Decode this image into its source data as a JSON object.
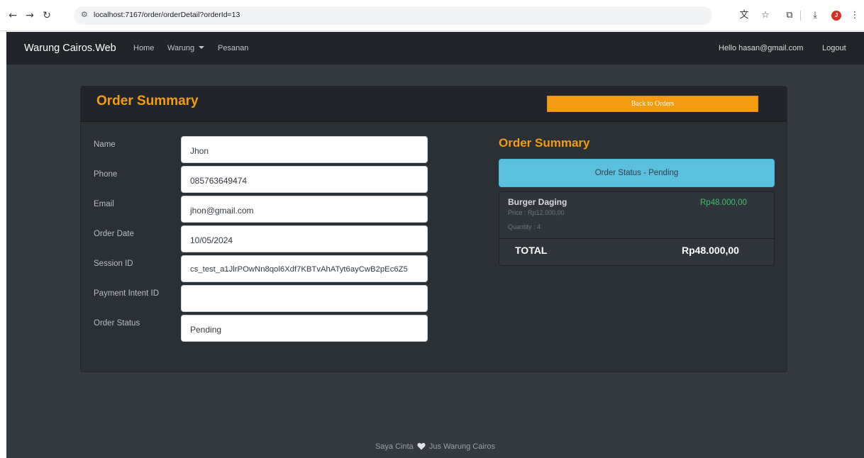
{
  "browser": {
    "url": "localhost:7167/order/orderDetail?orderId=13",
    "profile_initial": "J"
  },
  "navbar": {
    "brand": "Warung Cairos.Web",
    "links": {
      "home": "Home",
      "warung": "Warung",
      "pesanan": "Pesanan"
    },
    "greeting": "Hello hasan@gmail.com",
    "logout": "Logout"
  },
  "card": {
    "title": "Order Summary",
    "back_button": "Back to Orders",
    "fields": {
      "name": {
        "label": "Name",
        "value": "Jhon"
      },
      "phone": {
        "label": "Phone",
        "value": "085763649474"
      },
      "email": {
        "label": "Email",
        "value": "jhon@gmail.com"
      },
      "order_date": {
        "label": "Order Date",
        "value": "10/05/2024"
      },
      "session_id": {
        "label": "Session ID",
        "value": "cs_test_a1JlrPOwNn8qol6Xdf7KBTvAhATyt6ayCwB2pEc6Z5"
      },
      "payment_intent_id": {
        "label": "Payment Intent ID",
        "value": ""
      },
      "order_status": {
        "label": "Order Status",
        "value": "Pending"
      }
    },
    "summary": {
      "title": "Order Summary",
      "status": "Order Status - Pending",
      "item": {
        "name": "Burger Daging",
        "price": "Price : Rp12.000,00",
        "quantity": "Quantity : 4",
        "total": "Rp48.000,00"
      },
      "total_label": "TOTAL",
      "total_value": "Rp48.000,00"
    }
  },
  "footer": {
    "text_before": "Saya Cinta",
    "text_after": "Jus Warung Cairos"
  },
  "colors": {
    "accent": "#f39c12",
    "status_bg": "#5bc0de",
    "item_total": "#3fbf6b",
    "page_bg": "#343a40",
    "navbar_bg": "#212529"
  }
}
